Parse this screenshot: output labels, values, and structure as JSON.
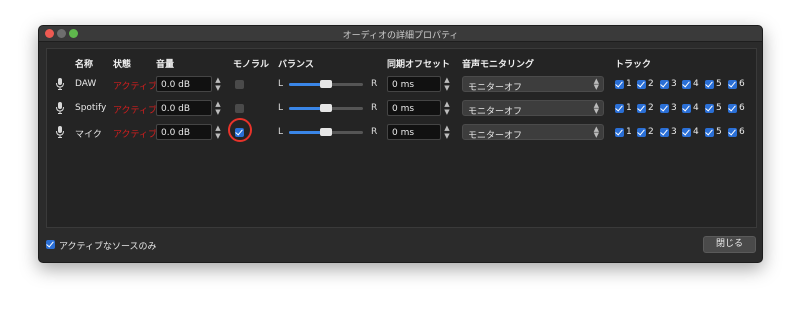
{
  "window": {
    "title": "オーディオの詳細プロパティ"
  },
  "headers": {
    "name": "名称",
    "status": "状態",
    "volume": "音量",
    "mono": "モノラル",
    "balance": "バランス",
    "sync_offset": "同期オフセット",
    "monitoring": "音声モニタリング",
    "tracks": "トラック"
  },
  "rows": [
    {
      "name": "DAW",
      "status": "アクティブ",
      "volume": "0.0 dB",
      "mono": false,
      "balance_l": "L",
      "balance_r": "R",
      "balance": 0.5,
      "sync": "0 ms",
      "monitoring": "モニターオフ",
      "tracks": [
        "1",
        "2",
        "3",
        "4",
        "5",
        "6"
      ]
    },
    {
      "name": "Spotify",
      "status": "アクティブ",
      "volume": "0.0 dB",
      "mono": false,
      "balance_l": "L",
      "balance_r": "R",
      "balance": 0.5,
      "sync": "0 ms",
      "monitoring": "モニターオフ",
      "tracks": [
        "1",
        "2",
        "3",
        "4",
        "5",
        "6"
      ]
    },
    {
      "name": "マイク",
      "status": "アクティブ",
      "volume": "0.0 dB",
      "mono": true,
      "balance_l": "L",
      "balance_r": "R",
      "balance": 0.5,
      "sync": "0 ms",
      "monitoring": "モニターオフ",
      "tracks": [
        "1",
        "2",
        "3",
        "4",
        "5",
        "6"
      ]
    }
  ],
  "footer": {
    "active_only_label": "アクティブなソースのみ",
    "active_only_checked": true,
    "close_label": "閉じる"
  },
  "colors": {
    "status_active": "#d21e1e",
    "checkbox_accent": "#2a6fd6",
    "slider_accent": "#3a86e8",
    "annotation_circle": "#e8332a"
  }
}
